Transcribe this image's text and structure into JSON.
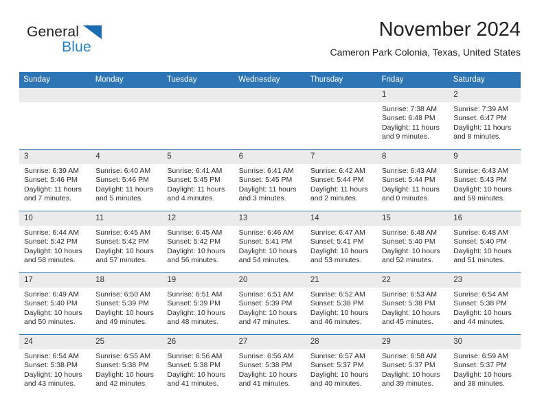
{
  "brand": {
    "name_part1": "General",
    "name_part2": "Blue"
  },
  "header": {
    "month_title": "November 2024",
    "location": "Cameron Park Colonia, Texas, United States"
  },
  "theme": {
    "header_blue": "#2e75b6",
    "brand_dark": "#231f20",
    "brand_blue": "#2480c8",
    "daynum_band": "#ebebeb",
    "text": "#2b2b2b"
  },
  "weekdays": [
    "Sunday",
    "Monday",
    "Tuesday",
    "Wednesday",
    "Thursday",
    "Friday",
    "Saturday"
  ],
  "labels": {
    "sunrise_prefix": "Sunrise: ",
    "sunset_prefix": "Sunset: ",
    "daylight_prefix": "Daylight: "
  },
  "weeks": [
    [
      {
        "day": "",
        "blank": true
      },
      {
        "day": "",
        "blank": true
      },
      {
        "day": "",
        "blank": true
      },
      {
        "day": "",
        "blank": true
      },
      {
        "day": "",
        "blank": true
      },
      {
        "day": "1",
        "sunrise": "Sunrise: 7:38 AM",
        "sunset": "Sunset: 6:48 PM",
        "daylight_1": "Daylight: 11 hours",
        "daylight_2": "and 9 minutes."
      },
      {
        "day": "2",
        "sunrise": "Sunrise: 7:39 AM",
        "sunset": "Sunset: 6:47 PM",
        "daylight_1": "Daylight: 11 hours",
        "daylight_2": "and 8 minutes."
      }
    ],
    [
      {
        "day": "3",
        "sunrise": "Sunrise: 6:39 AM",
        "sunset": "Sunset: 5:46 PM",
        "daylight_1": "Daylight: 11 hours",
        "daylight_2": "and 7 minutes."
      },
      {
        "day": "4",
        "sunrise": "Sunrise: 6:40 AM",
        "sunset": "Sunset: 5:46 PM",
        "daylight_1": "Daylight: 11 hours",
        "daylight_2": "and 5 minutes."
      },
      {
        "day": "5",
        "sunrise": "Sunrise: 6:41 AM",
        "sunset": "Sunset: 5:45 PM",
        "daylight_1": "Daylight: 11 hours",
        "daylight_2": "and 4 minutes."
      },
      {
        "day": "6",
        "sunrise": "Sunrise: 6:41 AM",
        "sunset": "Sunset: 5:45 PM",
        "daylight_1": "Daylight: 11 hours",
        "daylight_2": "and 3 minutes."
      },
      {
        "day": "7",
        "sunrise": "Sunrise: 6:42 AM",
        "sunset": "Sunset: 5:44 PM",
        "daylight_1": "Daylight: 11 hours",
        "daylight_2": "and 2 minutes."
      },
      {
        "day": "8",
        "sunrise": "Sunrise: 6:43 AM",
        "sunset": "Sunset: 5:44 PM",
        "daylight_1": "Daylight: 11 hours",
        "daylight_2": "and 0 minutes."
      },
      {
        "day": "9",
        "sunrise": "Sunrise: 6:43 AM",
        "sunset": "Sunset: 5:43 PM",
        "daylight_1": "Daylight: 10 hours",
        "daylight_2": "and 59 minutes."
      }
    ],
    [
      {
        "day": "10",
        "sunrise": "Sunrise: 6:44 AM",
        "sunset": "Sunset: 5:42 PM",
        "daylight_1": "Daylight: 10 hours",
        "daylight_2": "and 58 minutes."
      },
      {
        "day": "11",
        "sunrise": "Sunrise: 6:45 AM",
        "sunset": "Sunset: 5:42 PM",
        "daylight_1": "Daylight: 10 hours",
        "daylight_2": "and 57 minutes."
      },
      {
        "day": "12",
        "sunrise": "Sunrise: 6:45 AM",
        "sunset": "Sunset: 5:42 PM",
        "daylight_1": "Daylight: 10 hours",
        "daylight_2": "and 56 minutes."
      },
      {
        "day": "13",
        "sunrise": "Sunrise: 6:46 AM",
        "sunset": "Sunset: 5:41 PM",
        "daylight_1": "Daylight: 10 hours",
        "daylight_2": "and 54 minutes."
      },
      {
        "day": "14",
        "sunrise": "Sunrise: 6:47 AM",
        "sunset": "Sunset: 5:41 PM",
        "daylight_1": "Daylight: 10 hours",
        "daylight_2": "and 53 minutes."
      },
      {
        "day": "15",
        "sunrise": "Sunrise: 6:48 AM",
        "sunset": "Sunset: 5:40 PM",
        "daylight_1": "Daylight: 10 hours",
        "daylight_2": "and 52 minutes."
      },
      {
        "day": "16",
        "sunrise": "Sunrise: 6:48 AM",
        "sunset": "Sunset: 5:40 PM",
        "daylight_1": "Daylight: 10 hours",
        "daylight_2": "and 51 minutes."
      }
    ],
    [
      {
        "day": "17",
        "sunrise": "Sunrise: 6:49 AM",
        "sunset": "Sunset: 5:40 PM",
        "daylight_1": "Daylight: 10 hours",
        "daylight_2": "and 50 minutes."
      },
      {
        "day": "18",
        "sunrise": "Sunrise: 6:50 AM",
        "sunset": "Sunset: 5:39 PM",
        "daylight_1": "Daylight: 10 hours",
        "daylight_2": "and 49 minutes."
      },
      {
        "day": "19",
        "sunrise": "Sunrise: 6:51 AM",
        "sunset": "Sunset: 5:39 PM",
        "daylight_1": "Daylight: 10 hours",
        "daylight_2": "and 48 minutes."
      },
      {
        "day": "20",
        "sunrise": "Sunrise: 6:51 AM",
        "sunset": "Sunset: 5:39 PM",
        "daylight_1": "Daylight: 10 hours",
        "daylight_2": "and 47 minutes."
      },
      {
        "day": "21",
        "sunrise": "Sunrise: 6:52 AM",
        "sunset": "Sunset: 5:38 PM",
        "daylight_1": "Daylight: 10 hours",
        "daylight_2": "and 46 minutes."
      },
      {
        "day": "22",
        "sunrise": "Sunrise: 6:53 AM",
        "sunset": "Sunset: 5:38 PM",
        "daylight_1": "Daylight: 10 hours",
        "daylight_2": "and 45 minutes."
      },
      {
        "day": "23",
        "sunrise": "Sunrise: 6:54 AM",
        "sunset": "Sunset: 5:38 PM",
        "daylight_1": "Daylight: 10 hours",
        "daylight_2": "and 44 minutes."
      }
    ],
    [
      {
        "day": "24",
        "sunrise": "Sunrise: 6:54 AM",
        "sunset": "Sunset: 5:38 PM",
        "daylight_1": "Daylight: 10 hours",
        "daylight_2": "and 43 minutes."
      },
      {
        "day": "25",
        "sunrise": "Sunrise: 6:55 AM",
        "sunset": "Sunset: 5:38 PM",
        "daylight_1": "Daylight: 10 hours",
        "daylight_2": "and 42 minutes."
      },
      {
        "day": "26",
        "sunrise": "Sunrise: 6:56 AM",
        "sunset": "Sunset: 5:38 PM",
        "daylight_1": "Daylight: 10 hours",
        "daylight_2": "and 41 minutes."
      },
      {
        "day": "27",
        "sunrise": "Sunrise: 6:56 AM",
        "sunset": "Sunset: 5:38 PM",
        "daylight_1": "Daylight: 10 hours",
        "daylight_2": "and 41 minutes."
      },
      {
        "day": "28",
        "sunrise": "Sunrise: 6:57 AM",
        "sunset": "Sunset: 5:37 PM",
        "daylight_1": "Daylight: 10 hours",
        "daylight_2": "and 40 minutes."
      },
      {
        "day": "29",
        "sunrise": "Sunrise: 6:58 AM",
        "sunset": "Sunset: 5:37 PM",
        "daylight_1": "Daylight: 10 hours",
        "daylight_2": "and 39 minutes."
      },
      {
        "day": "30",
        "sunrise": "Sunrise: 6:59 AM",
        "sunset": "Sunset: 5:37 PM",
        "daylight_1": "Daylight: 10 hours",
        "daylight_2": "and 38 minutes."
      }
    ]
  ]
}
